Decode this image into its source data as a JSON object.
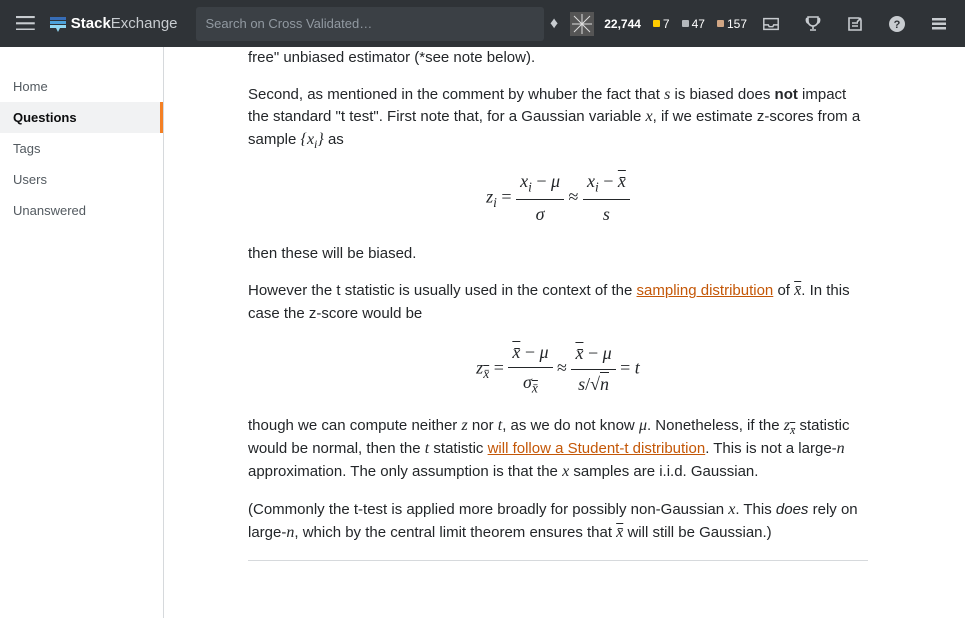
{
  "topbar": {
    "logo_bold": "Stack",
    "logo_light": "Exchange",
    "search_placeholder": "Search on Cross Validated…",
    "rep": "22,744",
    "gold": "7",
    "silver": "47",
    "bronze": "157"
  },
  "sidebar": {
    "items": [
      {
        "label": "Home",
        "active": false
      },
      {
        "label": "Questions",
        "active": true
      },
      {
        "label": "Tags",
        "active": false
      },
      {
        "label": "Users",
        "active": false
      },
      {
        "label": "Unanswered",
        "active": false
      }
    ]
  },
  "post": {
    "truncated_top": "free\" unbiased estimator (*see note below).",
    "p1_a": "Second, as mentioned in the comment by whuber the fact that ",
    "p1_s": "s",
    "p1_b": " is biased does ",
    "p1_not": "not",
    "p1_c": " impact the standard \"t test\". First note that, for a Gaussian variable ",
    "p1_x": "x",
    "p1_d": ", if we estimate z-scores from a sample ",
    "p1_set_open": "{",
    "p1_xi": "x",
    "p1_i": "i",
    "p1_set_close": "}",
    "p1_e": " as",
    "p2": "then these will be biased.",
    "p3_a": "However the t statistic is usually used in the context of the ",
    "p3_link": "sampling distribution",
    "p3_b": " of ",
    "p3_xbar": "x̄",
    "p3_c": ". In this case the z-score would be",
    "p4_a": "though we can compute neither ",
    "p4_z": "z",
    "p4_b": " nor ",
    "p4_t": "t",
    "p4_c": ", as we do not know ",
    "p4_mu": "μ",
    "p4_d": ". Nonetheless, if the ",
    "p4_zx": "z",
    "p4_zx_sub": "x̄",
    "p4_e": " statistic would be normal, then the ",
    "p4_t2": "t",
    "p4_f": " statistic ",
    "p4_link": "will follow a Student-t distribution",
    "p4_g": ". This is not a large-",
    "p4_n": "n",
    "p4_h": " approximation. The only assumption is that the ",
    "p4_x": "x",
    "p4_i_txt": " samples are i.i.d. Gaussian.",
    "p5_a": "(Commonly the t-test is applied more broadly for possibly non-Gaussian ",
    "p5_x": "x",
    "p5_b": ". This ",
    "p5_does": "does",
    "p5_c": " rely on large-",
    "p5_n": "n",
    "p5_d": ", which by the central limit theorem ensures that ",
    "p5_xbar": "x̄",
    "p5_e": " will still be Gaussian.)",
    "eq1": {
      "lhs_z": "z",
      "lhs_i": "i",
      "eq": " = ",
      "num1_x": "x",
      "num1_i": "i",
      "num1_minus": " − ",
      "num1_mu": "μ",
      "den1": "σ",
      "approx": " ≈ ",
      "num2_x": "x",
      "num2_i": "i",
      "num2_minus": " − ",
      "num2_xbar": "x̄",
      "den2": "s"
    },
    "eq2": {
      "lhs_z": "z",
      "lhs_sub": "x̄",
      "eq": " = ",
      "num1_xbar": "x̄",
      "num1_minus": " − ",
      "num1_mu": "μ",
      "den1_sigma": "σ",
      "den1_sub": "x̄",
      "approx": " ≈ ",
      "num2_xbar": "x̄",
      "num2_minus": " − ",
      "num2_mu": "μ",
      "den2_s": "s",
      "den2_slash": "/",
      "den2_sqrt": "√",
      "den2_n": "n",
      "eqt": " = ",
      "t": "t"
    }
  }
}
